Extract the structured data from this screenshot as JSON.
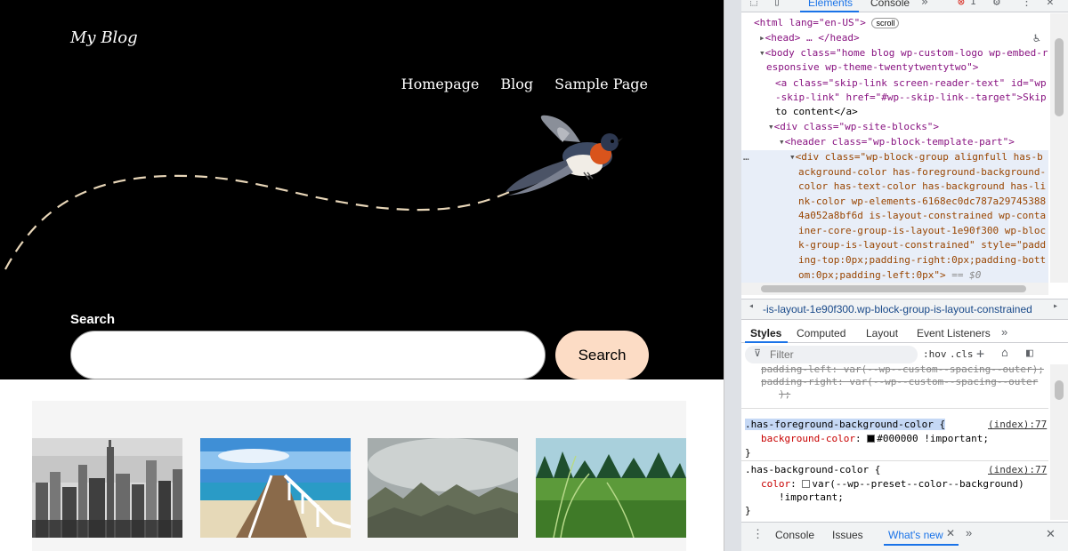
{
  "site": {
    "title": "My Blog",
    "nav": [
      "Homepage",
      "Blog",
      "Sample Page"
    ],
    "search": {
      "label": "Search",
      "placeholder": "",
      "button_label": "Search"
    },
    "gallery": [
      "City skyline photo",
      "Pier photo",
      "Misty forest photo",
      "Grass meadow photo"
    ]
  },
  "devtools": {
    "tabs": [
      "Elements",
      "Console"
    ],
    "error_count": "1",
    "tree": {
      "html_open": "<html lang=\"en-US\">",
      "scroll_badge": "scroll",
      "head": "<head> … </head>",
      "body_line1": "<body class=\"home blog wp-custom-logo wp-embed-r",
      "body_line2": "esponsive wp-theme-twentytwentytwo\">",
      "a_line1": "<a class=\"skip-link screen-reader-text\" id=\"wp",
      "a_line2": "-skip-link\" href=\"#wp--skip-link--target\">Skip",
      "a_line3": "to content</a>",
      "div_site": "<div class=\"wp-site-blocks\">",
      "header": "<header class=\"wp-block-template-part\">",
      "sel1": "<div class=\"wp-block-group alignfull has-b",
      "sel2": "ackground-color has-foreground-background-",
      "sel3": "color has-text-color has-background has-li",
      "sel4": "nk-color wp-elements-6168ec0dc787a29745388",
      "sel5": "4a052a8bf6d is-layout-constrained wp-conta",
      "sel6": "iner-core-group-is-layout-1e90f300 wp-bloc",
      "sel7": "k-group-is-layout-constrained\" style=\"padd",
      "sel8": "ing-top:0px;padding-right:0px;padding-bott",
      "sel9": "om:0px;padding-left:0px\">",
      "sel_suffix": "== $0",
      "dots": "…"
    },
    "breadcrumb": "-is-layout-1e90f300.wp-block-group-is-layout-constrained",
    "style_tabs": [
      "Styles",
      "Computed",
      "Layout",
      "Event Listeners"
    ],
    "filter_placeholder": "Filter",
    "filter_buttons": [
      ":hov",
      ".cls"
    ],
    "rules": {
      "struck1": "padding-left: var(--wp--custom--spacing--outer);",
      "struck2": "padding-right: var(--wp--custom--spacing--outer",
      "struck3": ");",
      "r1_selector": ".has-foreground-background-color {",
      "r1_source": "(index):77",
      "r1_prop": "background-color",
      "r1_value": "#000000 !important;",
      "r1_close": "}",
      "r2_selector": ".has-background-color {",
      "r2_source": "(index):77",
      "r2_prop": "color",
      "r2_value": "var(--wp--preset--color--background)",
      "r2_value2": "!important;",
      "r2_close": "}"
    },
    "drawer_tabs": [
      "Console",
      "Issues",
      "What's new"
    ],
    "colors": {
      "active_tab": "#1a73e8",
      "swatch_black": "#000000",
      "swatch_white": "#ffffff"
    }
  }
}
